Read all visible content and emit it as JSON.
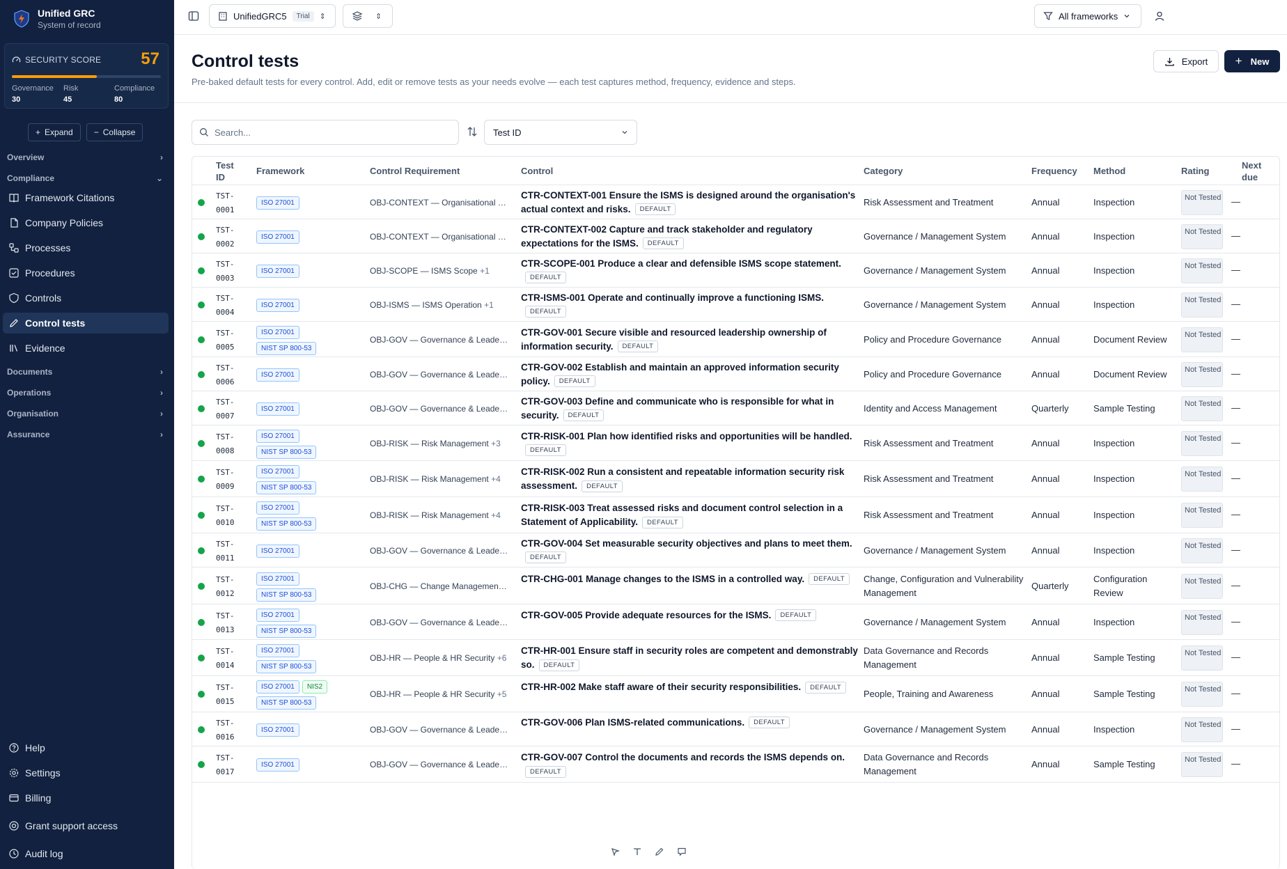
{
  "app": {
    "name": "Unified GRC",
    "subtitle": "System of record"
  },
  "score": {
    "label": "SECURITY SCORE",
    "value": "57",
    "fraction": 0.57,
    "governance_label": "Governance",
    "governance": "30",
    "risk_label": "Risk",
    "risk": "45",
    "compliance_label": "Compliance",
    "compliance": "80"
  },
  "controls": {
    "expand": "Expand",
    "collapse": "Collapse"
  },
  "nav": {
    "overview": "Overview",
    "compliance": "Compliance",
    "framework_citations": "Framework Citations",
    "company_policies": "Company Policies",
    "processes": "Processes",
    "procedures": "Procedures",
    "controls": "Controls",
    "control_tests": "Control tests",
    "evidence": "Evidence",
    "documents": "Documents",
    "operations": "Operations",
    "organisation": "Organisation",
    "assurance": "Assurance",
    "help": "Help",
    "settings": "Settings",
    "billing": "Billing",
    "grant_support": "Grant support access",
    "audit_log": "Audit log"
  },
  "topbar": {
    "workspace": "UnifiedGRC5",
    "trial": "Trial",
    "filter": "All frameworks"
  },
  "page": {
    "title": "Control tests",
    "subtitle": "Pre-baked default tests for every control. Add, edit or remove tests as your needs evolve — each test captures method, frequency, evidence and steps.",
    "export": "Export",
    "new": "New"
  },
  "filters": {
    "search_placeholder": "Search...",
    "sort_by": "Test ID"
  },
  "table": {
    "headers": {
      "test_id": "Test ID",
      "framework": "Framework",
      "requirement": "Control Requirement",
      "control": "Control",
      "category": "Category",
      "frequency": "Frequency",
      "method": "Method",
      "rating": "Rating",
      "next_due": "Next due"
    },
    "default_label": "DEFAULT",
    "rows": [
      {
        "id1": "TST-",
        "id2": "0001",
        "fw": [
          "ISO 27001"
        ],
        "req": "OBJ-CONTEXT — Organisational Co...",
        "more": "",
        "ctrl": "CTR-CONTEXT-001 Ensure the ISMS is designed around the organisation's actual context and risks.",
        "cat": "Risk Assessment and Treatment",
        "freq": "Annual",
        "meth": "Inspection",
        "rating": "Not Tested",
        "due": "—"
      },
      {
        "id1": "TST-",
        "id2": "0002",
        "fw": [
          "ISO 27001"
        ],
        "req": "OBJ-CONTEXT — Organisational Co...",
        "more": "",
        "ctrl": "CTR-CONTEXT-002 Capture and track stakeholder and regulatory expectations for the ISMS.",
        "cat": "Governance / Management System",
        "freq": "Annual",
        "meth": "Inspection",
        "rating": "Not Tested",
        "due": "—"
      },
      {
        "id1": "TST-",
        "id2": "0003",
        "fw": [
          "ISO 27001"
        ],
        "req": "OBJ-SCOPE — ISMS Scope",
        "more": "+1",
        "ctrl": "CTR-SCOPE-001 Produce a clear and defensible ISMS scope statement.",
        "cat": "Governance / Management System",
        "freq": "Annual",
        "meth": "Inspection",
        "rating": "Not Tested",
        "due": "—"
      },
      {
        "id1": "TST-",
        "id2": "0004",
        "fw": [
          "ISO 27001"
        ],
        "req": "OBJ-ISMS — ISMS Operation",
        "more": "+1",
        "ctrl": "CTR-ISMS-001 Operate and continually improve a functioning ISMS.",
        "cat": "Governance / Management System",
        "freq": "Annual",
        "meth": "Inspection",
        "rating": "Not Tested",
        "due": "—"
      },
      {
        "id1": "TST-",
        "id2": "0005",
        "fw": [
          "ISO 27001",
          "NIST SP 800-53"
        ],
        "req": "OBJ-GOV — Governance & Leaders...",
        "more": "",
        "ctrl": "CTR-GOV-001 Secure visible and resourced leadership ownership of information security.",
        "cat": "Policy and Procedure Governance",
        "freq": "Annual",
        "meth": "Document Review",
        "rating": "Not Tested",
        "due": "—"
      },
      {
        "id1": "TST-",
        "id2": "0006",
        "fw": [
          "ISO 27001"
        ],
        "req": "OBJ-GOV — Governance & Leaders...",
        "more": "",
        "ctrl": "CTR-GOV-002 Establish and maintain an approved information security policy.",
        "cat": "Policy and Procedure Governance",
        "freq": "Annual",
        "meth": "Document Review",
        "rating": "Not Tested",
        "due": "—"
      },
      {
        "id1": "TST-",
        "id2": "0007",
        "fw": [
          "ISO 27001"
        ],
        "req": "OBJ-GOV — Governance & Leaders...",
        "more": "",
        "ctrl": "CTR-GOV-003 Define and communicate who is responsible for what in security.",
        "cat": "Identity and Access Management",
        "freq": "Quarterly",
        "meth": "Sample Testing",
        "rating": "Not Tested",
        "due": "—"
      },
      {
        "id1": "TST-",
        "id2": "0008",
        "fw": [
          "ISO 27001",
          "NIST SP 800-53"
        ],
        "req": "OBJ-RISK — Risk Management",
        "more": "+3",
        "ctrl": "CTR-RISK-001 Plan how identified risks and opportunities will be handled.",
        "cat": "Risk Assessment and Treatment",
        "freq": "Annual",
        "meth": "Inspection",
        "rating": "Not Tested",
        "due": "—"
      },
      {
        "id1": "TST-",
        "id2": "0009",
        "fw": [
          "ISO 27001",
          "NIST SP 800-53"
        ],
        "req": "OBJ-RISK — Risk Management",
        "more": "+4",
        "ctrl": "CTR-RISK-002 Run a consistent and repeatable information security risk assessment.",
        "cat": "Risk Assessment and Treatment",
        "freq": "Annual",
        "meth": "Inspection",
        "rating": "Not Tested",
        "due": "—"
      },
      {
        "id1": "TST-",
        "id2": "0010",
        "fw": [
          "ISO 27001",
          "NIST SP 800-53"
        ],
        "req": "OBJ-RISK — Risk Management",
        "more": "+4",
        "ctrl": "CTR-RISK-003 Treat assessed risks and document control selection in a Statement of Applicability.",
        "cat": "Risk Assessment and Treatment",
        "freq": "Annual",
        "meth": "Inspection",
        "rating": "Not Tested",
        "due": "—"
      },
      {
        "id1": "TST-",
        "id2": "0011",
        "fw": [
          "ISO 27001"
        ],
        "req": "OBJ-GOV — Governance & Leaders...",
        "more": "",
        "ctrl": "CTR-GOV-004 Set measurable security objectives and plans to meet them.",
        "cat": "Governance / Management System",
        "freq": "Annual",
        "meth": "Inspection",
        "rating": "Not Tested",
        "due": "—"
      },
      {
        "id1": "TST-",
        "id2": "0012",
        "fw": [
          "ISO 27001",
          "NIST SP 800-53"
        ],
        "req": "OBJ-CHG — Change Management ...",
        "more": "",
        "ctrl": "CTR-CHG-001 Manage changes to the ISMS in a controlled way.",
        "cat": "Change, Configuration and Vulnerability Management",
        "freq": "Quarterly",
        "meth": "Configuration Review",
        "rating": "Not Tested",
        "due": "—"
      },
      {
        "id1": "TST-",
        "id2": "0013",
        "fw": [
          "ISO 27001",
          "NIST SP 800-53"
        ],
        "req": "OBJ-GOV — Governance & Leaders...",
        "more": "",
        "ctrl": "CTR-GOV-005 Provide adequate resources for the ISMS.",
        "cat": "Governance / Management System",
        "freq": "Annual",
        "meth": "Inspection",
        "rating": "Not Tested",
        "due": "—"
      },
      {
        "id1": "TST-",
        "id2": "0014",
        "fw": [
          "ISO 27001",
          "NIST SP 800-53"
        ],
        "req": "OBJ-HR — People & HR Security",
        "more": "+6",
        "ctrl": "CTR-HR-001 Ensure staff in security roles are competent and demonstrably so.",
        "cat": "Data Governance and Records Management",
        "freq": "Annual",
        "meth": "Sample Testing",
        "rating": "Not Tested",
        "due": "—"
      },
      {
        "id1": "TST-",
        "id2": "0015",
        "fw": [
          "ISO 27001",
          "NIS2",
          "NIST SP 800-53"
        ],
        "req": "OBJ-HR — People & HR Security",
        "more": "+5",
        "ctrl": "CTR-HR-002 Make staff aware of their security responsibilities.",
        "cat": "People, Training and Awareness",
        "freq": "Annual",
        "meth": "Sample Testing",
        "rating": "Not Tested",
        "due": "—"
      },
      {
        "id1": "TST-",
        "id2": "0016",
        "fw": [
          "ISO 27001"
        ],
        "req": "OBJ-GOV — Governance & Leaders...",
        "more": "",
        "ctrl": "CTR-GOV-006 Plan ISMS-related communications.",
        "cat": "Governance / Management System",
        "freq": "Annual",
        "meth": "Inspection",
        "rating": "Not Tested",
        "due": "—"
      },
      {
        "id1": "TST-",
        "id2": "0017",
        "fw": [
          "ISO 27001"
        ],
        "req": "OBJ-GOV — Governance & Leaders...",
        "more": "",
        "ctrl": "CTR-GOV-007 Control the documents and records the ISMS depends on.",
        "cat": "Data Governance and Records Management",
        "freq": "Annual",
        "meth": "Sample Testing",
        "rating": "Not Tested",
        "due": "—"
      }
    ]
  },
  "colors": {
    "sidebar_bg": "#12213f",
    "accent": "#f59e0b",
    "status_ok": "#16a34a",
    "primary_btn": "#12213f"
  }
}
